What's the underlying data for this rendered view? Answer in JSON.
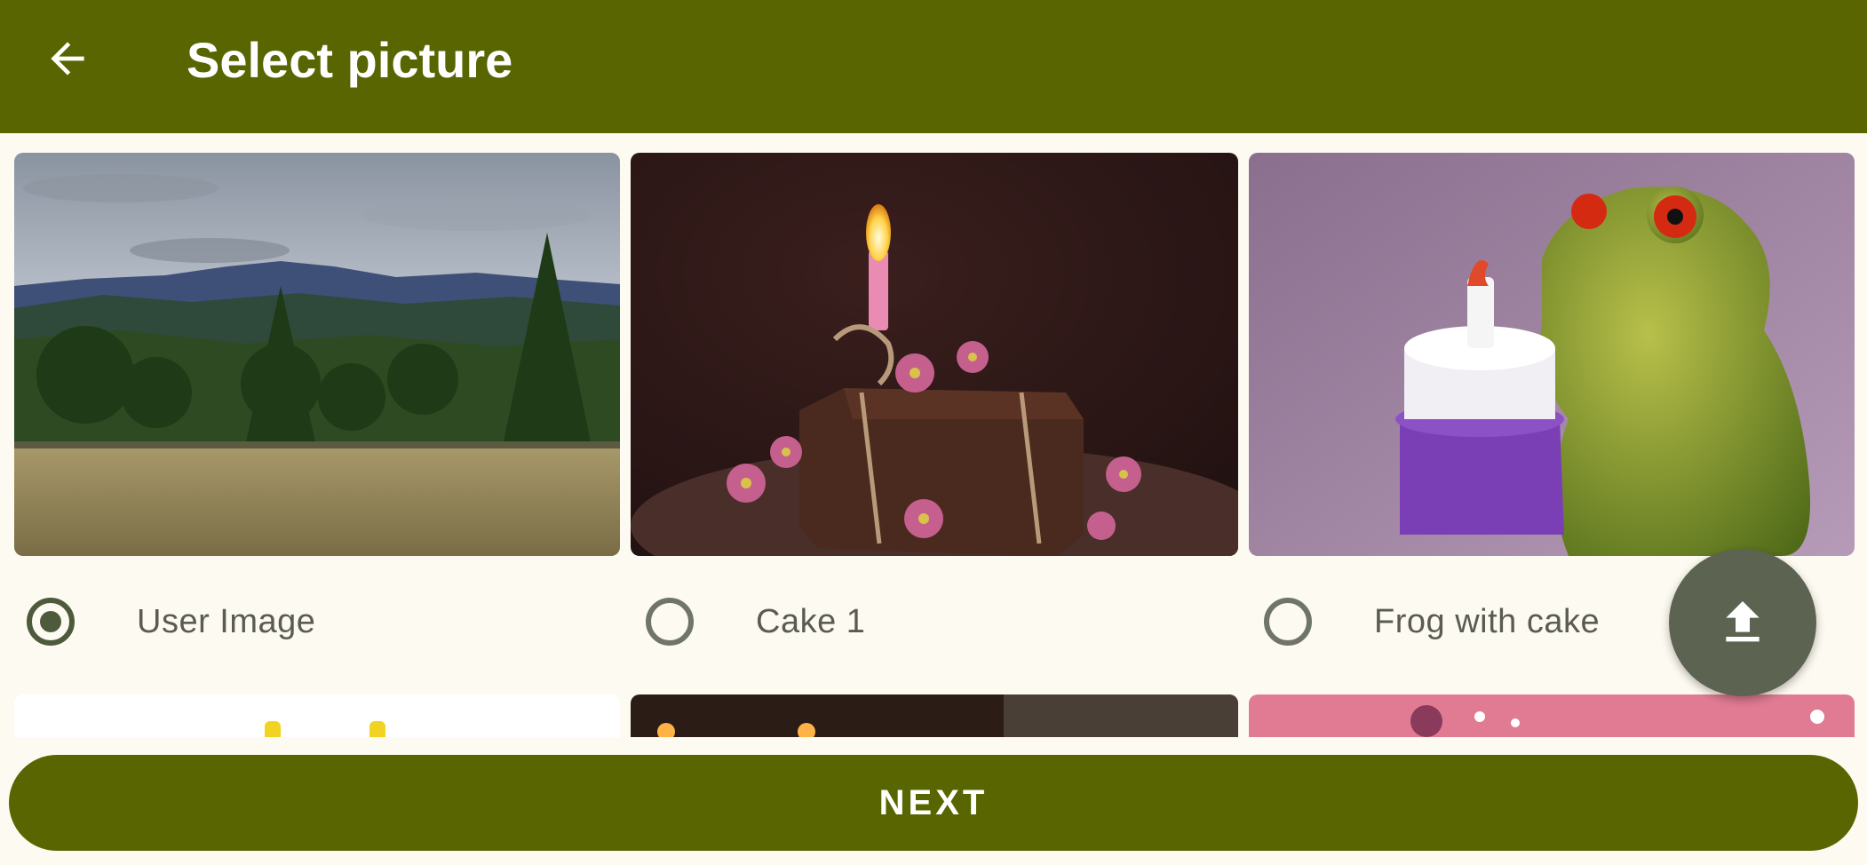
{
  "app_bar": {
    "title": "Select picture",
    "back_icon": "arrow-back-icon",
    "background": "#586500"
  },
  "pictures": [
    {
      "label": "User Image",
      "selected": true,
      "image": "mountain-landscape"
    },
    {
      "label": "Cake 1",
      "selected": false,
      "image": "cake-with-candle"
    },
    {
      "label": "Frog with cake",
      "selected": false,
      "image": "frog-figurine-with-cake"
    }
  ],
  "upload_fab": {
    "icon": "upload-icon",
    "color": "#5d6351"
  },
  "next_button": {
    "label": "NEXT",
    "color": "#586500"
  }
}
